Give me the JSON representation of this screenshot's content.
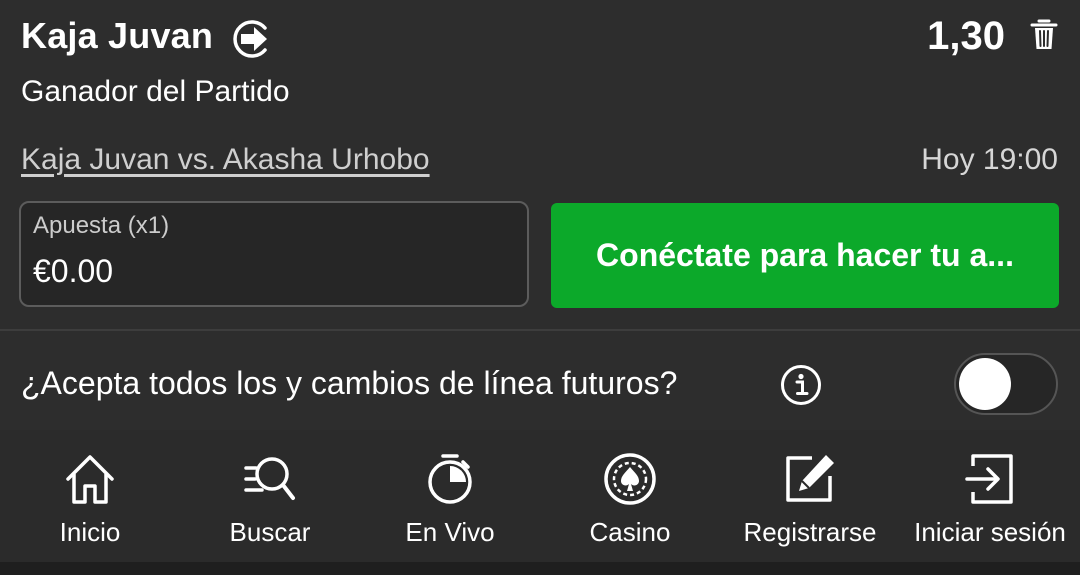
{
  "selection": {
    "name": "Kaja Juvan",
    "odds": "1,30",
    "market": "Ganador del Partido",
    "event": "Kaja Juvan vs. Akasha Urhobo",
    "time": "Hoy 19:00",
    "icons": {
      "arrow": "arrow-right-circle-icon",
      "delete": "trash-icon"
    }
  },
  "stake": {
    "label": "Apuesta (x1)",
    "value": "€0.00"
  },
  "login_button": {
    "label": "Conéctate para hacer tu a..."
  },
  "accept_changes": {
    "label": "¿Acepta todos los y cambios de línea futuros?",
    "toggle_on": false,
    "icon": "info-icon"
  },
  "nav": {
    "items": [
      {
        "label": "Inicio",
        "icon": "home-icon"
      },
      {
        "label": "Buscar",
        "icon": "search-icon"
      },
      {
        "label": "En Vivo",
        "icon": "stopwatch-icon"
      },
      {
        "label": "Casino",
        "icon": "casino-chip-icon"
      },
      {
        "label": "Registrarse",
        "icon": "edit-icon"
      },
      {
        "label": "Iniciar sesión",
        "icon": "login-icon"
      }
    ]
  },
  "colors": {
    "background": "#2b2b2b",
    "accent_green": "#0ca92a",
    "text": "#ffffff",
    "muted_text": "#cfcfcf"
  }
}
